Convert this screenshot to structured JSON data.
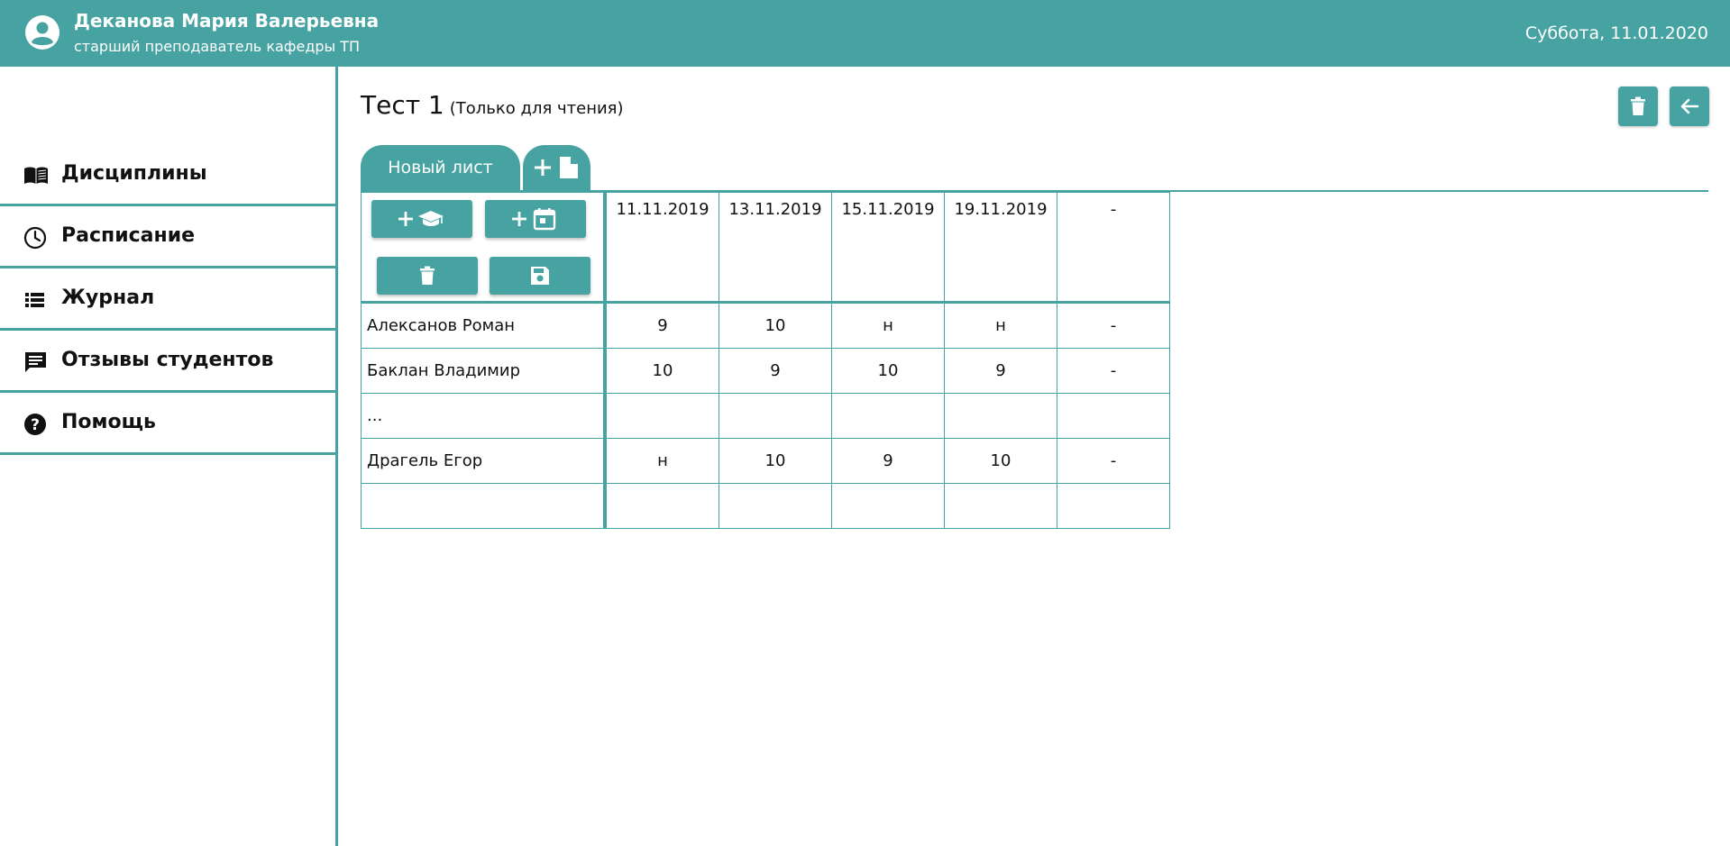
{
  "header": {
    "user_name": "Деканова Мария Валерьевна",
    "user_role": "старший преподаватель кафедры ТП",
    "current_date": "Суббота, 11.01.2020",
    "background_color": "#46a3a2"
  },
  "sidebar": {
    "items": [
      {
        "label": "Дисциплины",
        "icon": "book-icon"
      },
      {
        "label": "Расписание",
        "icon": "clock-icon"
      },
      {
        "label": "Журнал",
        "icon": "list-icon"
      },
      {
        "label": "Отзывы студентов",
        "icon": "comment-icon"
      },
      {
        "label": "Помощь",
        "icon": "help-icon"
      }
    ]
  },
  "main": {
    "title": "Тест 1",
    "title_note": "(Только для чтения)",
    "tabs": [
      {
        "label": "Новый лист",
        "active": true
      }
    ],
    "add_sheet_icon": "add-sheet-icon",
    "toolbar": {
      "delete_icon": "trash-icon",
      "back_icon": "arrow-left-icon"
    },
    "grid_tools": {
      "add_student_icon": "add-student-icon",
      "add_date_icon": "add-date-icon",
      "delete_icon": "trash-icon",
      "save_icon": "save-icon"
    },
    "table": {
      "dates": [
        "11.11.2019",
        "13.11.2019",
        "15.11.2019",
        "19.11.2019",
        "-"
      ],
      "rows": [
        {
          "name": "Алексанов Роман",
          "marks": [
            "9",
            "10",
            "н",
            "н",
            "-"
          ]
        },
        {
          "name": "Баклан Владимир",
          "marks": [
            "10",
            "9",
            "10",
            "9",
            "-"
          ]
        },
        {
          "name": "...",
          "marks": [
            "",
            "",
            "",
            "",
            ""
          ]
        },
        {
          "name": "Драгель Егор",
          "marks": [
            "н",
            "10",
            "9",
            "10",
            "-"
          ]
        },
        {
          "name": "",
          "marks": [
            "",
            "",
            "",
            "",
            ""
          ]
        }
      ]
    }
  }
}
